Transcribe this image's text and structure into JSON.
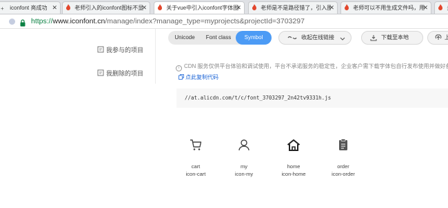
{
  "browser": {
    "tabs": [
      {
        "title": "iconfont 亮成功",
        "active": false
      },
      {
        "title": "老师引入的iconfont图标不显示",
        "active": false
      },
      {
        "title": "关于vue中引入iconfont字体图标",
        "active": true
      },
      {
        "title": "老师是不是路径错了，引入图",
        "active": false
      },
      {
        "title": "老师可以不用生成文件吗，用",
        "active": false
      },
      {
        "title": "关",
        "active": false
      }
    ],
    "url": {
      "scheme": "https://",
      "host": "www.iconfont.cn",
      "path": "/manage/index?manage_type=myprojects&projectId=3703297"
    }
  },
  "sidebar": {
    "items": [
      {
        "label": "我参与的项目",
        "icon": "shared-project-icon"
      },
      {
        "label": "我删除的项目",
        "icon": "deleted-project-icon"
      }
    ]
  },
  "format_tabs": [
    {
      "label": "Unicode",
      "selected": false
    },
    {
      "label": "Font class",
      "selected": false
    },
    {
      "label": "Symbol",
      "selected": true
    }
  ],
  "toolbar": {
    "collapse_link_label": "收起在线链接",
    "download_label": "下载至本地",
    "upload_label": "上传"
  },
  "notice": "CDN 服务仅供平台体验和调试使用，平台不承诺服务的稳定性，企业客户需下载字体包自行发布使用并做好备份。",
  "copy_code_label": "点此复制代码",
  "code_url": "//at.alicdn.com/t/c/font_3703297_2n42tv9331h.js",
  "icons": [
    {
      "name": "cart",
      "code": "icon-cart",
      "icon": "cart-icon"
    },
    {
      "name": "my",
      "code": "icon-my",
      "icon": "user-icon"
    },
    {
      "name": "home",
      "code": "icon-home",
      "icon": "home-icon"
    },
    {
      "name": "order",
      "code": "icon-order",
      "icon": "order-icon"
    }
  ],
  "colors": {
    "accent": "#4c9bf5",
    "link": "#1a63d6",
    "scheme_green": "#0b8043"
  }
}
